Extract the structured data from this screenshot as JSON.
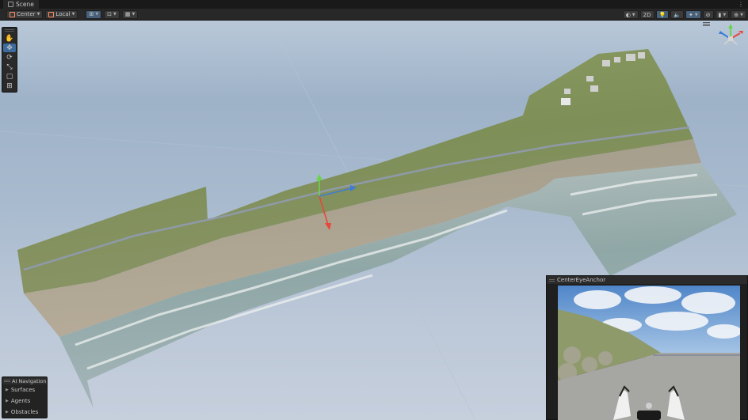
{
  "window": {
    "tab_title": "Scene",
    "menu_glyph": "⋮"
  },
  "toolbar": {
    "pivot_label": "Center",
    "space_label": "Local",
    "view_2d_label": "2D"
  },
  "tools": [
    {
      "name": "view-tool",
      "glyph": "✋"
    },
    {
      "name": "move-tool",
      "glyph": "✥"
    },
    {
      "name": "rotate-tool",
      "glyph": "⟳"
    },
    {
      "name": "scale-tool",
      "glyph": "⤡"
    },
    {
      "name": "rect-tool",
      "glyph": "▢"
    },
    {
      "name": "transform-tool",
      "glyph": "⊞"
    }
  ],
  "ai_navigation": {
    "title": "AI Navigation",
    "items": [
      "Surfaces",
      "Agents",
      "Obstacles"
    ]
  },
  "camera_preview": {
    "title": "CenterEyeAnchor"
  },
  "colors": {
    "toolbar_bg": "#282828",
    "active_tool": "#3d6b9b",
    "axis_x": "#e8473c",
    "axis_y": "#6cd44c",
    "axis_z": "#3e7bd6"
  }
}
